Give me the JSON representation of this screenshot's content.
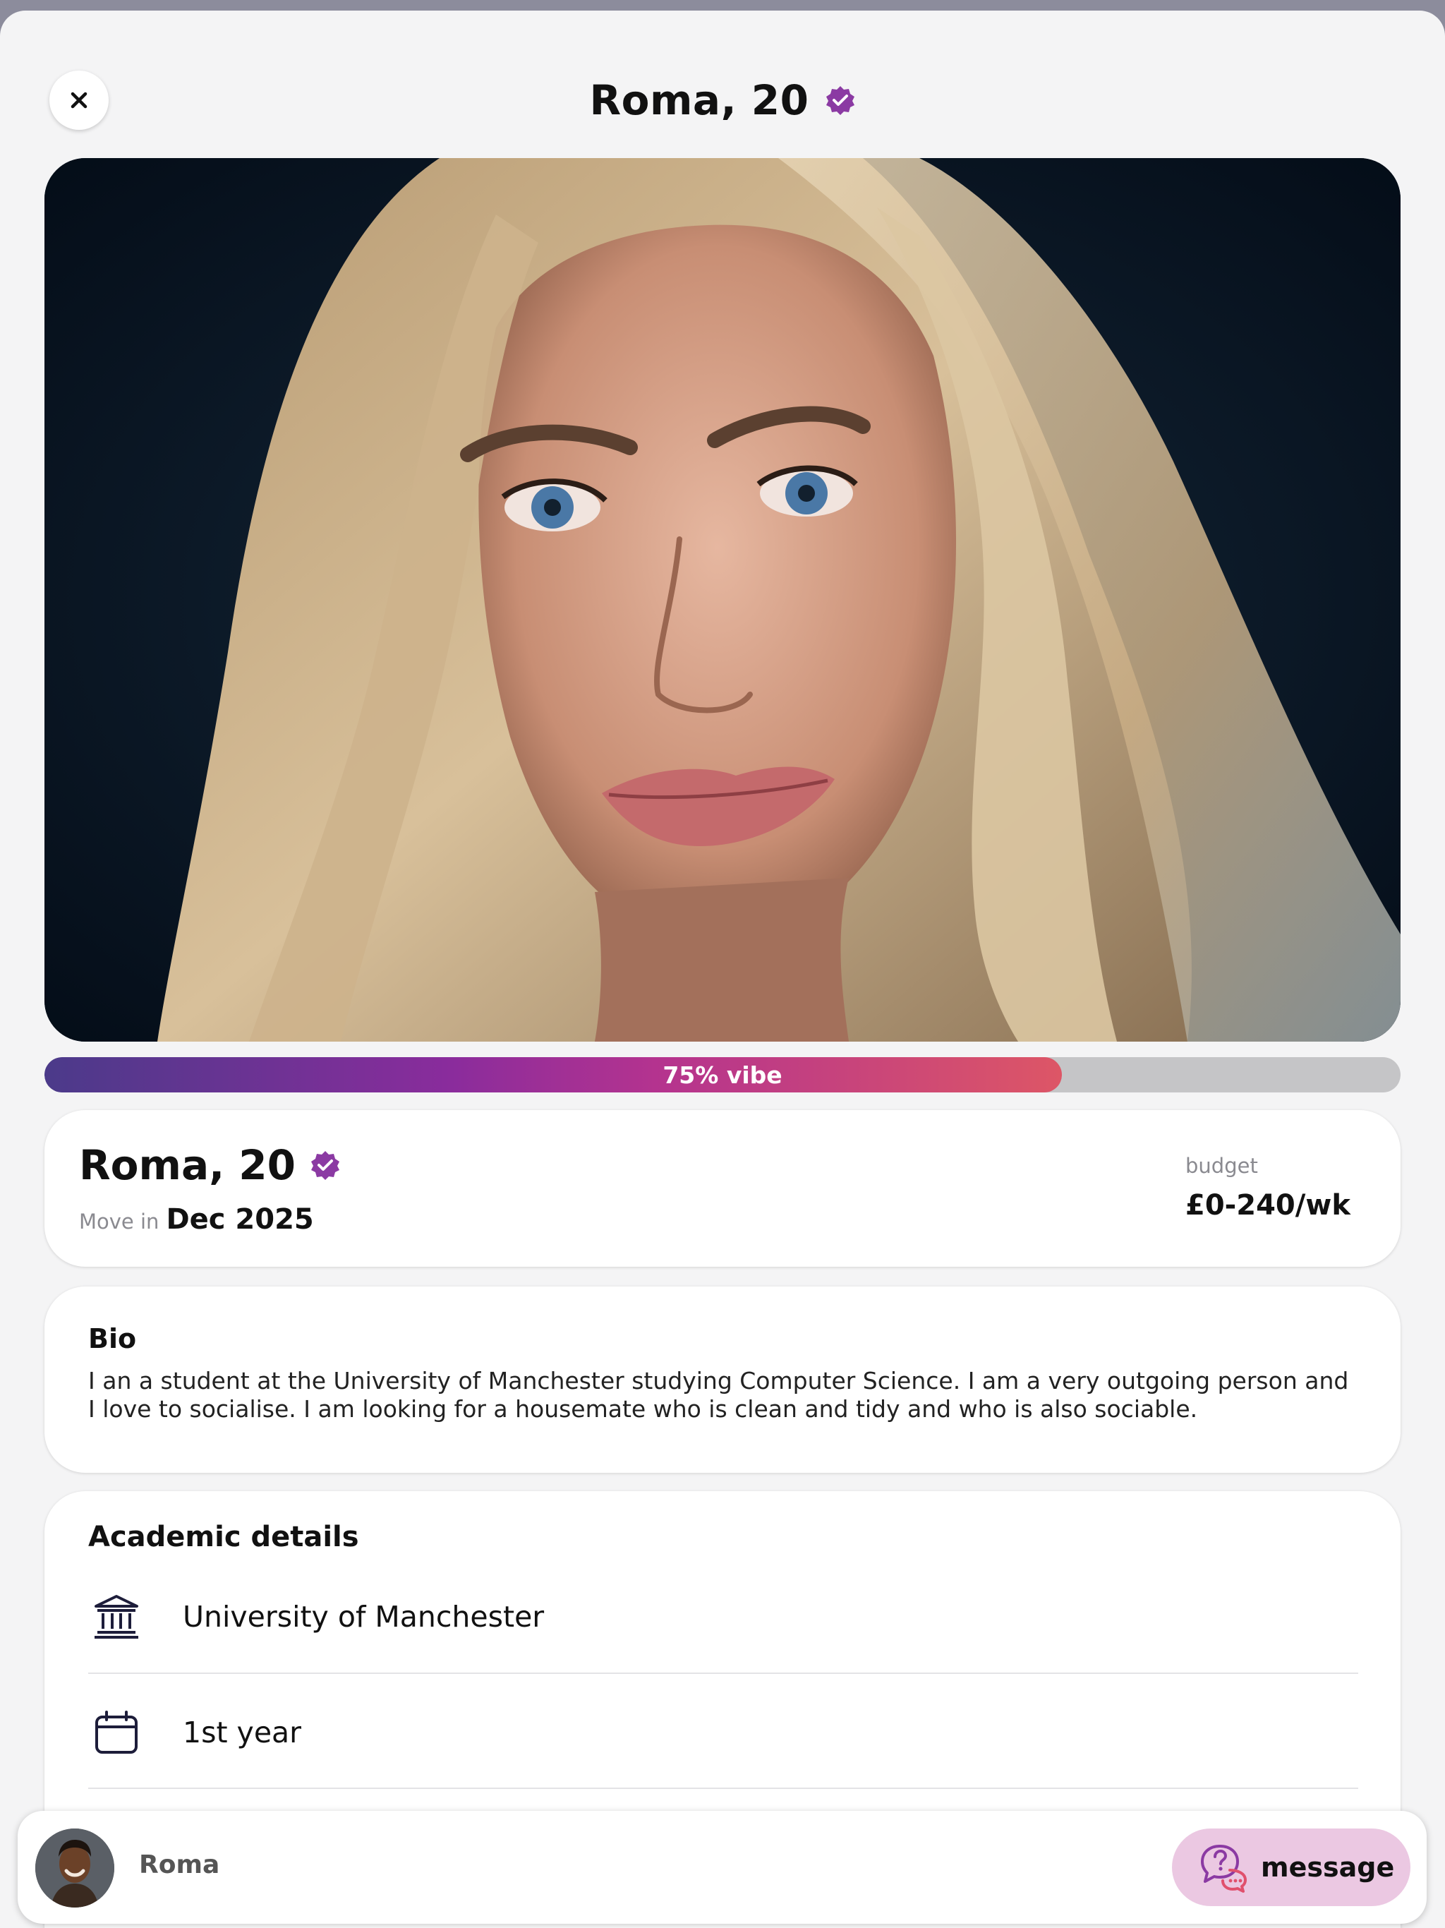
{
  "header": {
    "title": "Roma, 20",
    "close_icon": "close-icon",
    "verified_icon": "verified-badge-icon"
  },
  "photo": {
    "alt": "profile-photo"
  },
  "vibe": {
    "label": "75% vibe",
    "percent": 75
  },
  "summary": {
    "name": "Roma, 20",
    "move_label": "Move in",
    "move_value": "Dec 2025",
    "budget_label": "budget",
    "budget_value": "£0-240/wk"
  },
  "bio": {
    "title": "Bio",
    "text": "I an a student at the University of Manchester studying Computer Science. I am a very outgoing person and I love to socialise. I am looking for a housemate who is clean and tidy and who is also sociable."
  },
  "academic": {
    "title": "Academic details",
    "items": [
      {
        "icon": "university-icon",
        "label": "University of Manchester"
      },
      {
        "icon": "calendar-icon",
        "label": "1st year"
      }
    ]
  },
  "bottom_bar": {
    "name": "Roma",
    "message_label": "message",
    "message_icon": "chat-question-icon"
  },
  "colors": {
    "accent_purple": "#7b3a9c",
    "vibe_start": "#4b3a8a",
    "vibe_end": "#dd5666",
    "message_bg": "#ebc8e2"
  }
}
